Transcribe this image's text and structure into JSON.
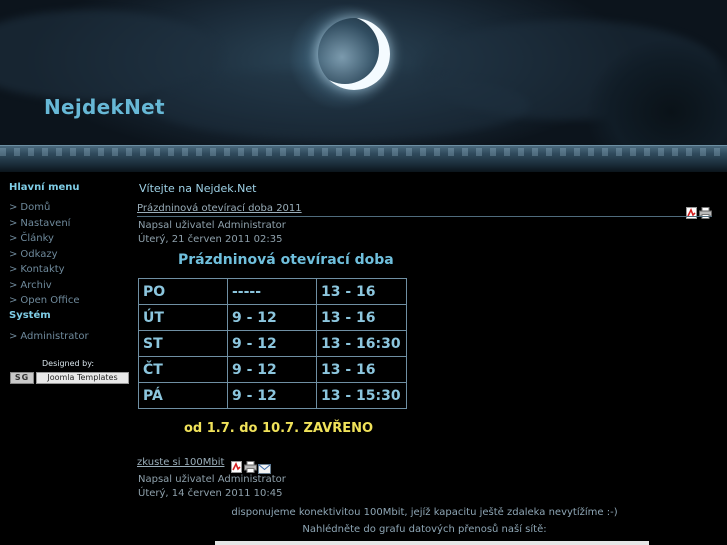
{
  "header": {
    "site_title": "NejdekNet"
  },
  "sidebar": {
    "main_menu_title": "Hlavní menu",
    "main_items": [
      {
        "label": "Domů"
      },
      {
        "label": "Nastavení"
      },
      {
        "label": "Články"
      },
      {
        "label": "Odkazy"
      },
      {
        "label": "Kontakty"
      },
      {
        "label": "Archiv"
      },
      {
        "label": "Open Office"
      }
    ],
    "system_title": "Systém",
    "system_items": [
      {
        "label": "Administrator"
      }
    ],
    "arrow": ">",
    "designed_by": "Designed by:",
    "badge_sg": "SG",
    "badge_joomla": "Joomla Templates"
  },
  "main": {
    "welcome": "Vítejte na Nejdek.Net",
    "article1": {
      "title_link": "Prázdninová otevírací doba 2011",
      "author": "Napsal uživatel Administrator",
      "date": "Úterý, 21 červen 2011 02:35",
      "heading": "Prázdninová otevírací doba",
      "hours": [
        [
          "PO",
          "-----",
          "13 - 16"
        ],
        [
          "ÚT",
          "9 - 12",
          "13 - 16"
        ],
        [
          "ST",
          "9 - 12",
          "13 - 16:30"
        ],
        [
          "ČT",
          "9 - 12",
          "13 - 16"
        ],
        [
          "PÁ",
          "9 - 12",
          "13 - 15:30"
        ]
      ],
      "closed_note": "od 1.7. do 10.7. ZAVŘENO",
      "icons": [
        "pdf-icon",
        "print-icon"
      ]
    },
    "article2": {
      "title_link": "zkuste si 100Mbit",
      "author": "Napsal uživatel Administrator",
      "date": "Úterý, 14 červen 2011 10:45",
      "line1": "disponujeme konektivitou 100Mbit, jejíž kapacitu ještě zdaleka nevytížíme :-)",
      "line2": "Nahlédněte do grafu datových přenosů naší sítě:",
      "icons": [
        "pdf-icon",
        "print-icon",
        "email-icon"
      ]
    }
  },
  "colors": {
    "accent": "#67b8d6",
    "highlight_yellow": "#f0e25a",
    "background": "#000000"
  }
}
